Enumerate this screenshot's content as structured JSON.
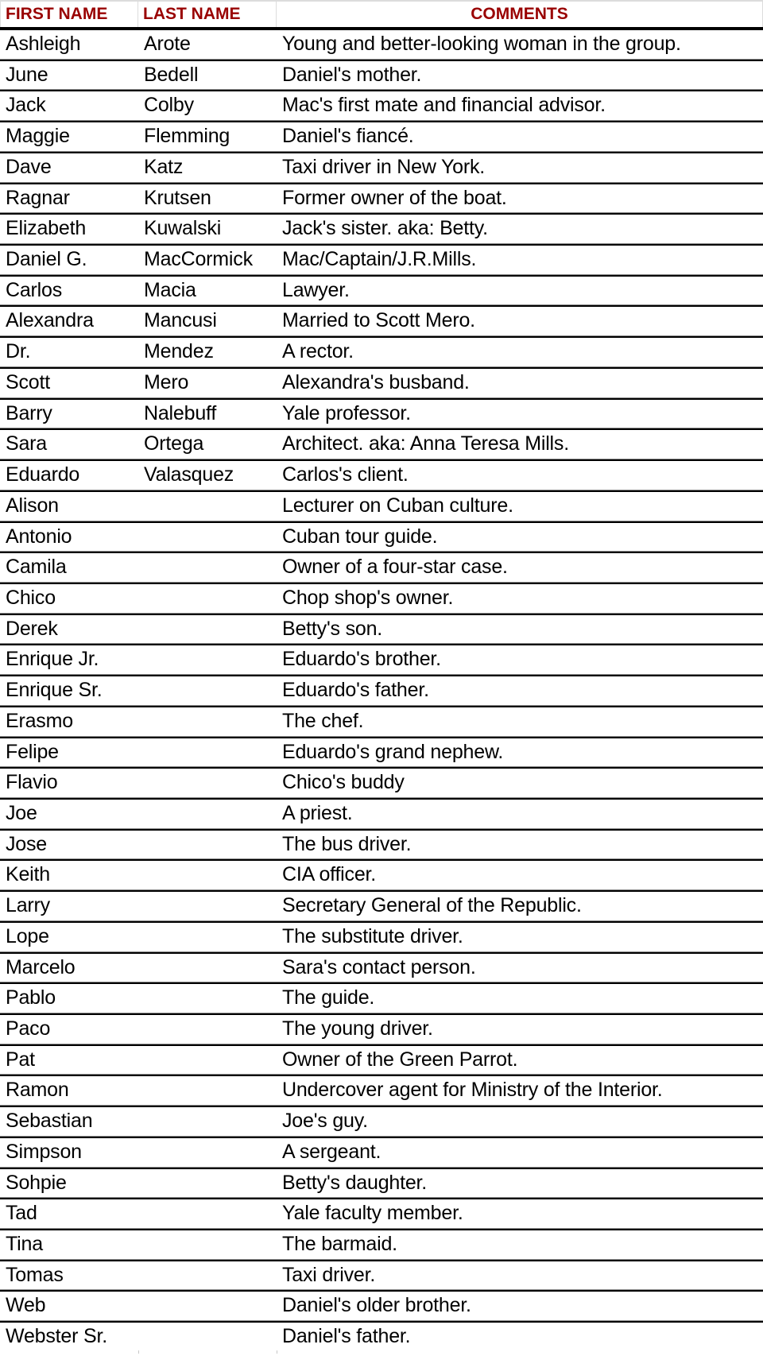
{
  "table": {
    "headers": {
      "first_name": "FIRST NAME",
      "last_name": "LAST NAME",
      "comments": "COMMENTS"
    },
    "header_color": "#990000",
    "rows": [
      {
        "first": "Ashleigh",
        "last": "Arote",
        "comment": "Young and better-looking woman in the group."
      },
      {
        "first": "June",
        "last": "Bedell",
        "comment": "Daniel's mother."
      },
      {
        "first": "Jack",
        "last": "Colby",
        "comment": "Mac's first mate and financial advisor."
      },
      {
        "first": "Maggie",
        "last": "Flemming",
        "comment": "Daniel's fiancé."
      },
      {
        "first": "Dave",
        "last": "Katz",
        "comment": "Taxi driver in New York."
      },
      {
        "first": "Ragnar",
        "last": "Krutsen",
        "comment": "Former owner of the boat."
      },
      {
        "first": "Elizabeth",
        "last": "Kuwalski",
        "comment": "Jack's sister. aka: Betty."
      },
      {
        "first": "Daniel G.",
        "last": "MacCormick",
        "comment": "Mac/Captain/J.R.Mills."
      },
      {
        "first": "Carlos",
        "last": "Macia",
        "comment": "Lawyer."
      },
      {
        "first": "Alexandra",
        "last": "Mancusi",
        "comment": "Married to Scott Mero."
      },
      {
        "first": "Dr.",
        "last": "Mendez",
        "comment": "A rector."
      },
      {
        "first": "Scott",
        "last": "Mero",
        "comment": "Alexandra's busband."
      },
      {
        "first": "Barry",
        "last": "Nalebuff",
        "comment": "Yale professor."
      },
      {
        "first": "Sara",
        "last": "Ortega",
        "comment": "Architect. aka: Anna Teresa Mills."
      },
      {
        "first": "Eduardo",
        "last": "Valasquez",
        "comment": "Carlos's client."
      },
      {
        "first": "Alison",
        "last": "",
        "comment": "Lecturer on Cuban culture."
      },
      {
        "first": "Antonio",
        "last": "",
        "comment": "Cuban tour guide."
      },
      {
        "first": "Camila",
        "last": "",
        "comment": "Owner of a four-star case."
      },
      {
        "first": "Chico",
        "last": "",
        "comment": "Chop shop's owner."
      },
      {
        "first": "Derek",
        "last": "",
        "comment": "Betty's son."
      },
      {
        "first": "Enrique Jr.",
        "last": "",
        "comment": "Eduardo's brother."
      },
      {
        "first": "Enrique Sr.",
        "last": "",
        "comment": "Eduardo's father."
      },
      {
        "first": "Erasmo",
        "last": "",
        "comment": "The chef."
      },
      {
        "first": "Felipe",
        "last": "",
        "comment": "Eduardo's grand nephew."
      },
      {
        "first": "Flavio",
        "last": "",
        "comment": "Chico's buddy"
      },
      {
        "first": "Joe",
        "last": "",
        "comment": "A priest."
      },
      {
        "first": "Jose",
        "last": "",
        "comment": "The bus driver."
      },
      {
        "first": "Keith",
        "last": "",
        "comment": "CIA officer."
      },
      {
        "first": "Larry",
        "last": "",
        "comment": "Secretary General of the Republic."
      },
      {
        "first": "Lope",
        "last": "",
        "comment": "The substitute driver."
      },
      {
        "first": "Marcelo",
        "last": "",
        "comment": "Sara's contact person."
      },
      {
        "first": "Pablo",
        "last": "",
        "comment": "The guide."
      },
      {
        "first": "Paco",
        "last": "",
        "comment": "The young driver."
      },
      {
        "first": "Pat",
        "last": "",
        "comment": "Owner of the Green Parrot."
      },
      {
        "first": "Ramon",
        "last": "",
        "comment": "Undercover agent for Ministry of the Interior."
      },
      {
        "first": "Sebastian",
        "last": "",
        "comment": "Joe's guy."
      },
      {
        "first": "Simpson",
        "last": "",
        "comment": "A sergeant."
      },
      {
        "first": "Sohpie",
        "last": "",
        "comment": "Betty's daughter."
      },
      {
        "first": "Tad",
        "last": "",
        "comment": "Yale faculty member."
      },
      {
        "first": "Tina",
        "last": "",
        "comment": "The barmaid."
      },
      {
        "first": "Tomas",
        "last": "",
        "comment": "Taxi driver."
      },
      {
        "first": "Web",
        "last": "",
        "comment": "Daniel's older brother."
      },
      {
        "first": "Webster Sr.",
        "last": "",
        "comment": "Daniel's father."
      }
    ]
  }
}
